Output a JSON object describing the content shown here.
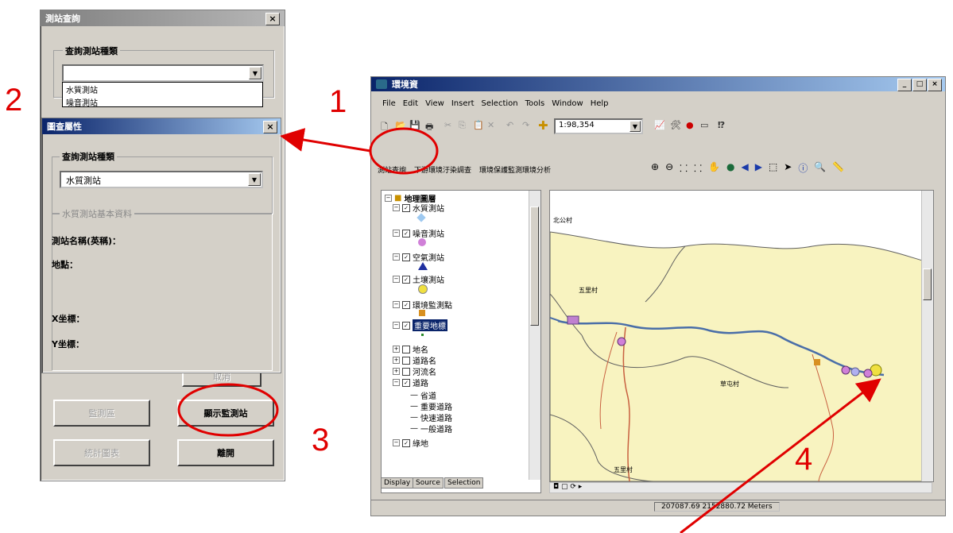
{
  "step_numbers": [
    "1",
    "2",
    "3",
    "4"
  ],
  "dialog_back": {
    "title": "測站查詢",
    "group_label": "查詢測站種類",
    "dropdown_value": "",
    "dropdown_options": [
      "水質測站",
      "噪音測站"
    ],
    "buttons": {
      "btn_left_1": "監測區",
      "btn_right_1": "顯示監測站",
      "btn_left_2": "統計圖表",
      "btn_right_2": "離開",
      "btn_hidden": "取消"
    }
  },
  "dialog_front": {
    "title": "圖查屬性",
    "group_label": "查詢測站種類",
    "dropdown_value": "水質測站",
    "info_group_label": "水質測站基本資料",
    "fields": {
      "station_name": "測站名稱(英稱)：",
      "address": "地點：",
      "x_coord": "X坐標：",
      "y_coord": "Y坐標："
    }
  },
  "arcmap": {
    "title": "環境資",
    "window_buttons": [
      "_",
      "□",
      "×"
    ],
    "menu": [
      "File",
      "Edit",
      "View",
      "Insert",
      "Selection",
      "Tools",
      "Window",
      "Help"
    ],
    "scale": "1:98,354",
    "custom_tools": [
      "測站查詢",
      "下游環境汙染調查",
      "環境保護監測環境分析"
    ],
    "toc": {
      "root": "地理圖層",
      "layers": [
        {
          "name": "水質測站",
          "checked": true
        },
        {
          "name": "噪音測站",
          "checked": true
        },
        {
          "name": "空氣測站",
          "checked": true
        },
        {
          "name": "土壤測站",
          "checked": true
        },
        {
          "name": "環境監測點",
          "checked": true
        },
        {
          "name": "重要地標",
          "checked": true,
          "selected": true
        },
        {
          "name": "地名",
          "checked": false
        },
        {
          "name": "道路名",
          "checked": false
        },
        {
          "name": "河流名",
          "checked": false
        },
        {
          "name": "道路",
          "checked": true
        }
      ],
      "road_legend": [
        "省道",
        "重要道路",
        "快速道路",
        "一般道路"
      ],
      "last_layer": "綠地",
      "tabs": [
        "Display",
        "Source",
        "Selection"
      ]
    },
    "map_labels": [
      "北公村",
      "五里村",
      "草屯村",
      "五里村"
    ],
    "status_coords": "207087.69 2152880.72 Meters",
    "colors": {
      "land": "#f8f3c0",
      "river": "#4a6ea8",
      "road": "#c86040",
      "boundary": "#606060",
      "annotation": "#e00000"
    }
  }
}
